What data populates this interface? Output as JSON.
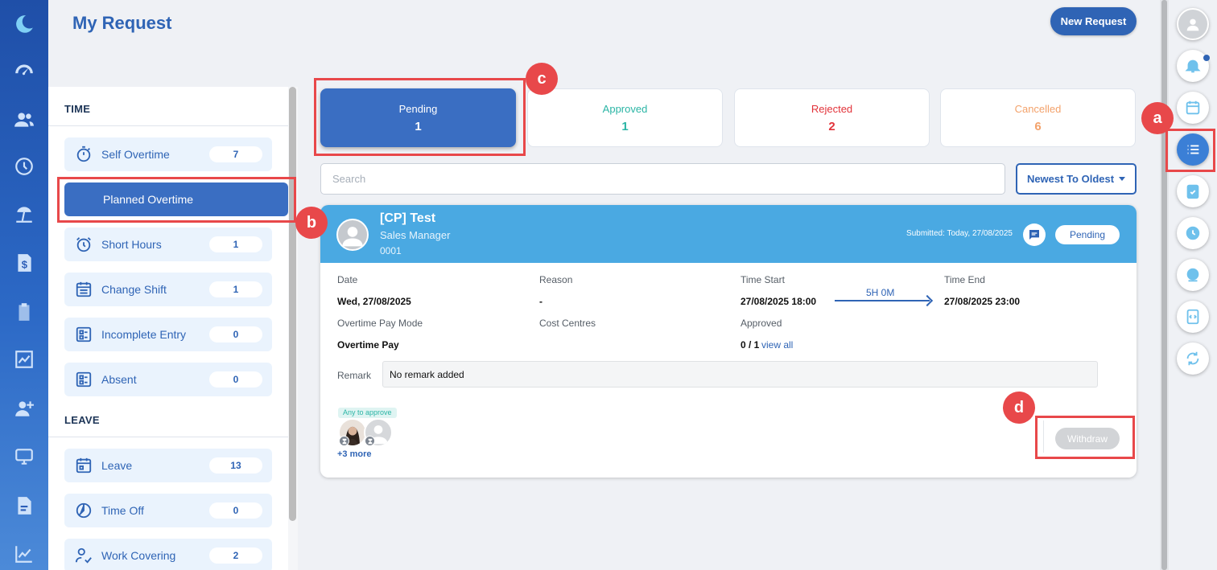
{
  "header": {
    "title": "My Request",
    "new_request_label": "New Request"
  },
  "sidebar": {
    "time_heading": "TIME",
    "leave_heading": "LEAVE",
    "time_items": [
      {
        "label": "Self Overtime",
        "count": "7"
      },
      {
        "label": "Planned Overtime",
        "count": ""
      },
      {
        "label": "Short Hours",
        "count": "1"
      },
      {
        "label": "Change Shift",
        "count": "1"
      },
      {
        "label": "Incomplete Entry",
        "count": "0"
      },
      {
        "label": "Absent",
        "count": "0"
      }
    ],
    "leave_items": [
      {
        "label": "Leave",
        "count": "13"
      },
      {
        "label": "Time Off",
        "count": "0"
      },
      {
        "label": "Work Covering",
        "count": "2"
      }
    ]
  },
  "status_tabs": [
    {
      "label": "Pending",
      "count": "1",
      "color": "#ffffff"
    },
    {
      "label": "Approved",
      "count": "1",
      "color": "#2bb5a5"
    },
    {
      "label": "Rejected",
      "count": "2",
      "color": "#e2333a"
    },
    {
      "label": "Cancelled",
      "count": "6",
      "color": "#f3a26b"
    }
  ],
  "search": {
    "placeholder": "Search",
    "value": ""
  },
  "sort": {
    "label": "Newest To Oldest"
  },
  "request": {
    "name": "[CP] Test",
    "role": "Sales Manager",
    "employee_id": "0001",
    "submitted": "Submitted: Today, 27/08/2025",
    "status": "Pending",
    "date_label": "Date",
    "date_value": "Wed, 27/08/2025",
    "reason_label": "Reason",
    "reason_value": "-",
    "time_start_label": "Time Start",
    "time_start_value": "27/08/2025 18:00",
    "duration": "5H 0M",
    "time_end_label": "Time End",
    "time_end_value": "27/08/2025 23:00",
    "pay_mode_label": "Overtime Pay Mode",
    "pay_mode_value": "Overtime Pay",
    "cost_centres_label": "Cost Centres",
    "approved_label": "Approved",
    "approved_value": "0 / 1",
    "view_all": "view all",
    "remark_label": "Remark",
    "remark_value": "No remark added",
    "approve_tag": "Any to approve",
    "more_approvers": "+3 more",
    "withdraw_label": "Withdraw"
  },
  "annotations": {
    "a": "a",
    "b": "b",
    "c": "c",
    "d": "d"
  },
  "colors": {
    "primary": "#2f64b5",
    "card_header": "#4aa9e2",
    "annotation": "#e8484a"
  }
}
